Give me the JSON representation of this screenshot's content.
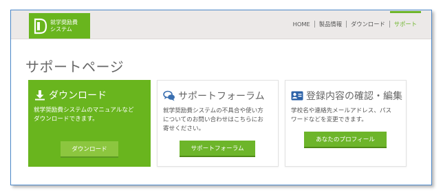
{
  "header": {
    "logo_line1": "就学奨励費",
    "logo_line2": "システム",
    "nav": [
      {
        "label": "HOME"
      },
      {
        "label": "製品情報"
      },
      {
        "label": "ダウンロード"
      },
      {
        "label": "サポート"
      }
    ],
    "active_nav": "サポート"
  },
  "page_title": "サポートページ",
  "cards": [
    {
      "title": "ダウンロード",
      "icon": "download-icon",
      "desc_lines": [
        "就学奨励費システムのマニュアルなど",
        "ダウンロードできます。"
      ],
      "button": "ダウンロード"
    },
    {
      "title": "サポートフォーラム",
      "icon": "chat-bubbles-icon",
      "desc_lines": [
        "就学奨励費システムの不具合や使い方",
        "についてのお問い合わせはこちらにお",
        "寄せください。"
      ],
      "button": "サポートフォーラム"
    },
    {
      "title": "登録内容の確認・編集",
      "icon": "id-card-icon",
      "desc_lines": [
        "学校名や連絡先メールアドレス、パス",
        "ワードなどを変更できます。"
      ],
      "button": "あなたのプロフィール"
    }
  ],
  "colors": {
    "brand_green": "#69b51e",
    "button_green": "#6db52a",
    "light_button_green": "#8cc63f",
    "frame_border": "#4a86c8"
  }
}
